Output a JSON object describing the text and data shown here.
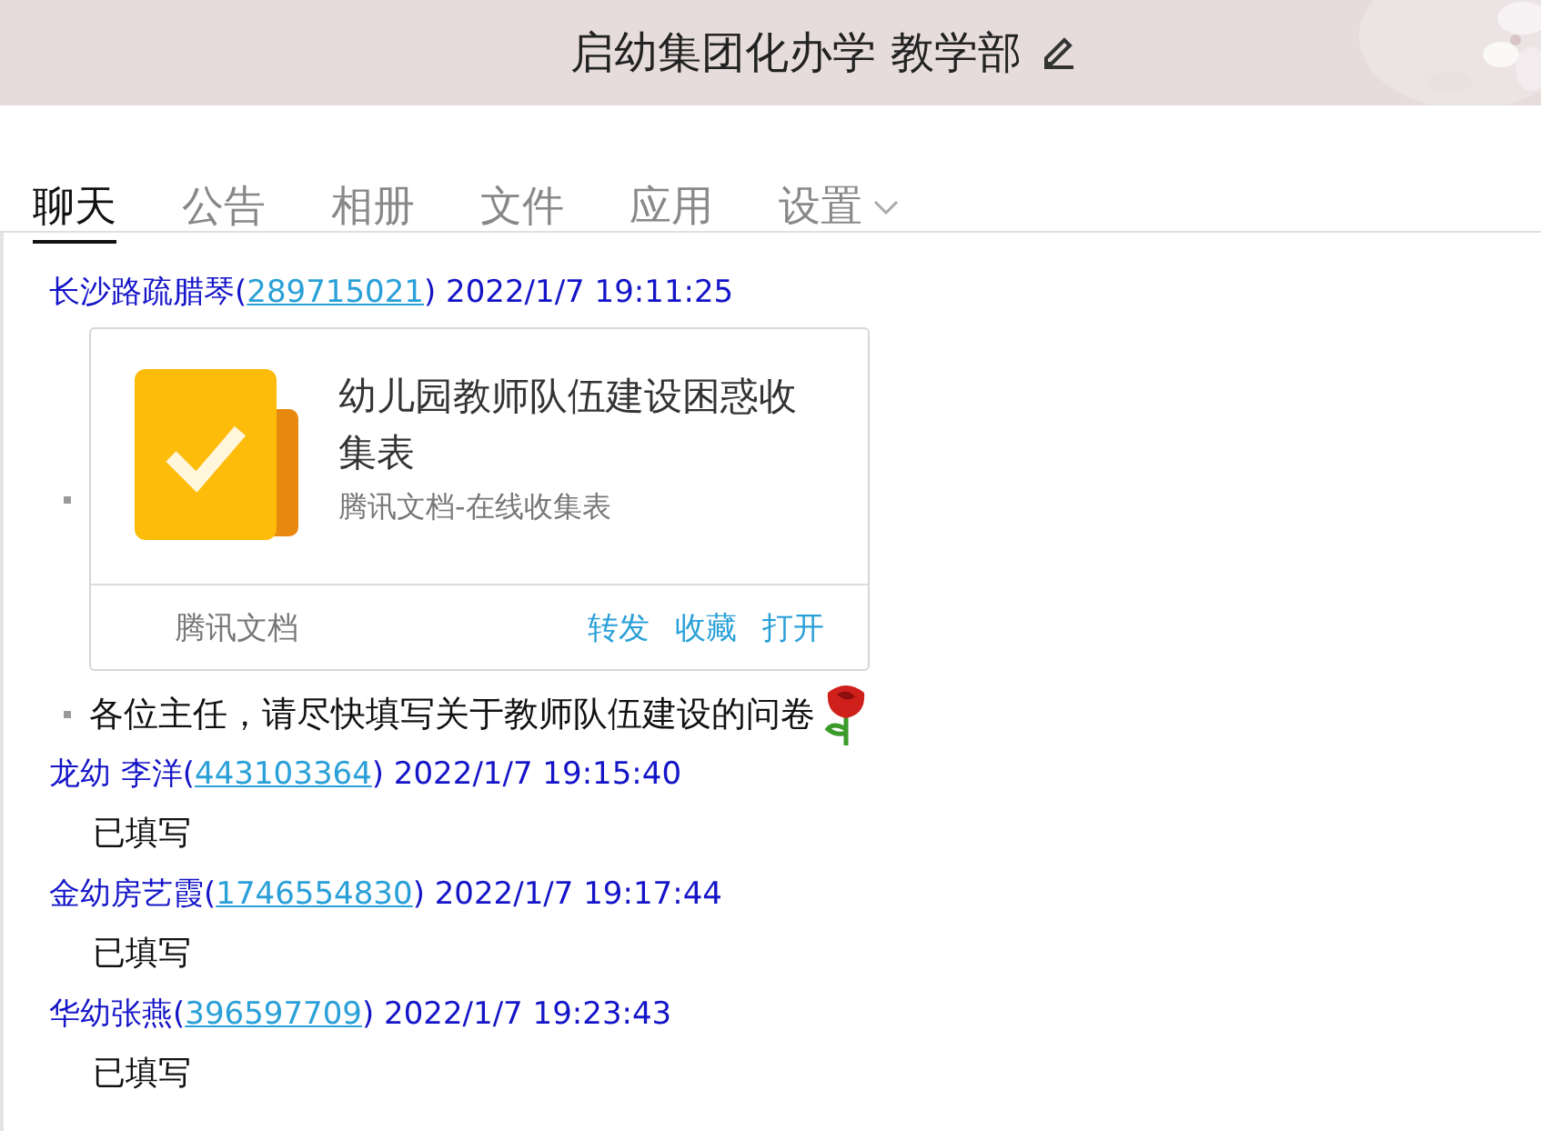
{
  "window": {
    "title": "启幼集团化办学 教学部"
  },
  "tabs": [
    {
      "label": "聊天",
      "selected": true
    },
    {
      "label": "公告",
      "selected": false
    },
    {
      "label": "相册",
      "selected": false
    },
    {
      "label": "文件",
      "selected": false
    },
    {
      "label": "应用",
      "selected": false
    },
    {
      "label": "设置",
      "selected": false,
      "dropdown": true
    }
  ],
  "messages": [
    {
      "sender": "长沙路疏腊琴(",
      "qq": "289715021",
      "time": ") 2022/1/7 19:11:25",
      "items": [
        {
          "kind": "card",
          "title": "幼儿园教师队伍建设困惑收集表",
          "subtitle": "腾讯文档-在线收集表",
          "source": "腾讯文档",
          "actions": [
            "转发",
            "收藏",
            "打开"
          ]
        },
        {
          "kind": "text",
          "text": "各位主任，请尽快填写关于教师队伍建设的问卷",
          "emoji": true
        }
      ]
    },
    {
      "sender": "龙幼  李洋(",
      "qq": "443103364",
      "time": ") 2022/1/7 19:15:40",
      "items": [
        {
          "kind": "plain",
          "text": "已填写"
        }
      ]
    },
    {
      "sender": "金幼房艺霞(",
      "qq": "1746554830",
      "time": ") 2022/1/7 19:17:44",
      "items": [
        {
          "kind": "plain",
          "text": "已填写"
        }
      ]
    },
    {
      "sender": "华幼张燕(",
      "qq": "396597709",
      "time": ") 2022/1/7 19:23:43",
      "items": [
        {
          "kind": "plain",
          "text": "已填写"
        }
      ]
    }
  ]
}
